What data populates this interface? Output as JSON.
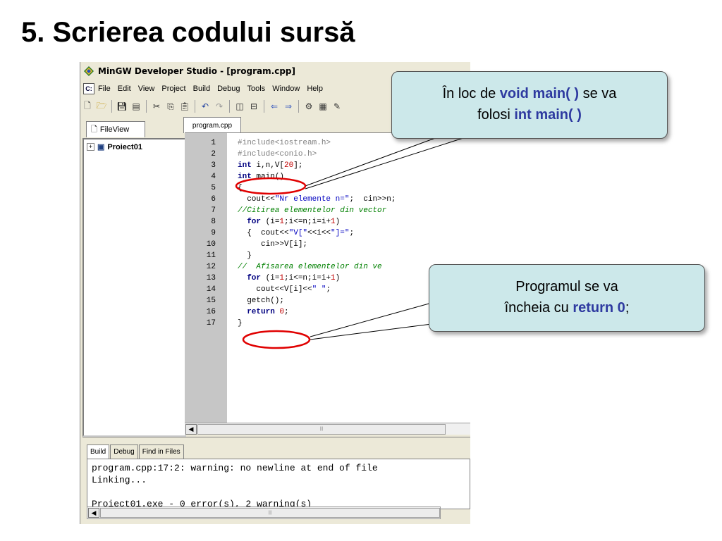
{
  "slide": {
    "title": "5. Scrierea codului sursă"
  },
  "window": {
    "title": "MinGW Developer Studio - [program.cpp]",
    "menu": [
      "File",
      "Edit",
      "View",
      "Project",
      "Build",
      "Debug",
      "Tools",
      "Window",
      "Help"
    ],
    "toolbar_icons": [
      "new-file-icon",
      "open-folder-icon",
      "save-icon",
      "save-all-icon",
      "cut-icon",
      "copy-icon",
      "paste-icon",
      "undo-icon",
      "redo-icon",
      "layout-icon",
      "split-icon",
      "back-arrow-icon",
      "forward-arrow-icon",
      "build-icon",
      "calendar-icon",
      "tools-icon"
    ]
  },
  "left_panel": {
    "tab_label": "FileView",
    "tree_root": "Proiect01"
  },
  "editor": {
    "tab_label": "program.cpp",
    "lines": [
      {
        "num": "1",
        "html": "<span class='pp'>#include&lt;iostream.h&gt;</span>"
      },
      {
        "num": "2",
        "html": "<span class='pp'>#include&lt;conio.h&gt;</span>"
      },
      {
        "num": "3",
        "html": "<span class='kw'>int</span> i,n,V[<span class='num'>20</span>];"
      },
      {
        "num": "4",
        "html": "<span class='kw'>int</span> main()"
      },
      {
        "num": "5",
        "html": "{"
      },
      {
        "num": "6",
        "html": "  cout&lt;&lt;<span class='str'>\"Nr elemente n=\"</span>;  cin&gt;&gt;n;"
      },
      {
        "num": "7",
        "html": "<span class='cm'>//Citirea elementelor din vector</span>"
      },
      {
        "num": "8",
        "html": "  <span class='kw'>for</span> (i=<span class='num'>1</span>;i&lt;=n;i=i+<span class='num'>1</span>)"
      },
      {
        "num": "9",
        "html": "  {  cout&lt;&lt;<span class='str'>\"V[\"</span>&lt;&lt;i&lt;&lt;<span class='str'>\"]=\"</span>;"
      },
      {
        "num": "10",
        "html": "     cin&gt;&gt;V[i];"
      },
      {
        "num": "11",
        "html": "  }"
      },
      {
        "num": "12",
        "html": "<span class='cm'>//  Afisarea elementelor din ve</span>"
      },
      {
        "num": "13",
        "html": "  <span class='kw'>for</span> (i=<span class='num'>1</span>;i&lt;=n;i=i+<span class='num'>1</span>)"
      },
      {
        "num": "14",
        "html": "    cout&lt;&lt;V[i]&lt;&lt;<span class='str'>\" \"</span>;"
      },
      {
        "num": "15",
        "html": "  getch();"
      },
      {
        "num": "16",
        "html": "  <span class='kw'>return</span> <span class='num'>0</span>;"
      },
      {
        "num": "17",
        "html": "}"
      }
    ]
  },
  "output": {
    "tabs": [
      "Build",
      "Debug",
      "Find in Files"
    ],
    "lines": [
      "program.cpp:17:2: warning: no newline at end of file",
      "Linking...",
      "",
      "Proiect01.exe - 0 error(s), 2 warning(s)"
    ]
  },
  "callouts": {
    "c1": {
      "pre": "În loc de ",
      "hl1": "void main( )",
      "mid": " se va",
      "line2_pre": "folosi ",
      "hl2": "int main( )"
    },
    "c2": {
      "line1": "Programul se va",
      "line2_pre": "încheia cu ",
      "hl": "return 0",
      "post": ";"
    }
  },
  "colors": {
    "callout_bg": "#cce8ea",
    "highlight": "#2e3aa0",
    "red_circle": "#e00000"
  }
}
